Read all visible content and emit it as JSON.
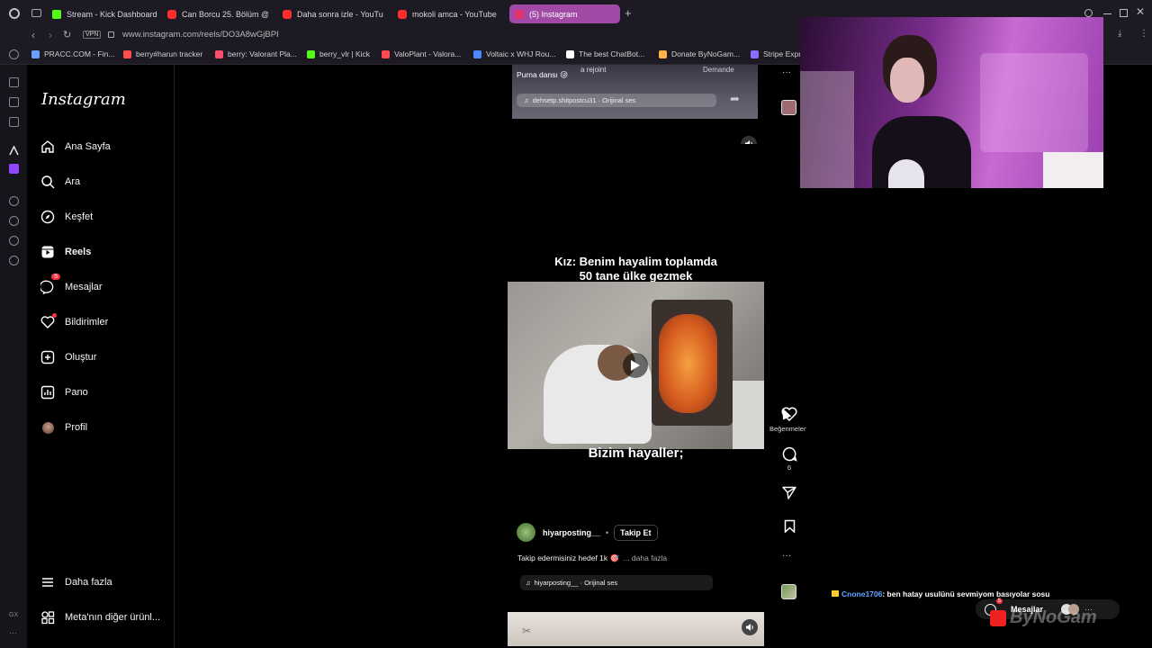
{
  "browser": {
    "tabs": [
      {
        "title": "Stream - Kick Dashboard",
        "color": "#53fc18"
      },
      {
        "title": "Can Borcu 25. Bölüm @...",
        "color": "#ff2d2d"
      },
      {
        "title": "Daha sonra izle - YouTube",
        "color": "#ff2d2d"
      },
      {
        "title": "mokoli amca - YouTube",
        "color": "#ff2d2d"
      },
      {
        "title": "(5) Instagram",
        "color": "#e1306c"
      }
    ],
    "url": "www.instagram.com/reels/DO3A8wGjBPI",
    "vpn_label": "VPN",
    "bookmarks": [
      {
        "label": "PRACC.COM - Fin...",
        "color": "#6aa0ff"
      },
      {
        "label": "berry#harun tracker",
        "color": "#ff4d4d"
      },
      {
        "label": "berry: Valorant Pla...",
        "color": "#ff4d6d"
      },
      {
        "label": "berry_vlr | Kick",
        "color": "#53fc18"
      },
      {
        "label": "ValoPlant - Valora...",
        "color": "#ff4655"
      },
      {
        "label": "Voltaic x WHJ Rou...",
        "color": "#4a8cff"
      },
      {
        "label": "The best ChatBot...",
        "color": "#ffffff"
      },
      {
        "label": "Donate ByNoGam...",
        "color": "#ffb347"
      },
      {
        "label": "Stripe Expr...",
        "color": "#8a6cff"
      }
    ]
  },
  "instagram": {
    "logo": "Instagram",
    "nav": [
      {
        "label": "Ana Sayfa",
        "icon": "home-icon"
      },
      {
        "label": "Ara",
        "icon": "search-icon"
      },
      {
        "label": "Keşfet",
        "icon": "compass-icon"
      },
      {
        "label": "Reels",
        "icon": "reels-icon"
      },
      {
        "label": "Mesajlar",
        "icon": "messenger-icon",
        "badge": "5"
      },
      {
        "label": "Bildirimler",
        "icon": "heart-icon"
      },
      {
        "label": "Oluştur",
        "icon": "plus-icon"
      },
      {
        "label": "Pano",
        "icon": "dashboard-icon"
      },
      {
        "label": "Profil",
        "icon": "avatar-icon"
      }
    ],
    "more_label": "Daha fazla",
    "meta_label": "Meta'nın diğer ürünl..."
  },
  "prev_reel": {
    "caption": "Purna dansı 😜",
    "audio": "dehsetp.shitpostcu31 · Orijinal ses",
    "overlay_left": "a rejoint",
    "overlay_right": "Demande"
  },
  "current_reel": {
    "top_text_line1": "Kız: Benim hayalim toplamda",
    "top_text_line2": "50 tane ülke gezmek",
    "bottom_text": "Bizim hayaller;",
    "username": "hiyarposting__",
    "follow_label": "Takip Et",
    "caption": "Takip edermisiniz hedef 1k 🎯",
    "more_label": "... daha fazla",
    "audio": "hiyarposting__ · Orijinal ses",
    "likes_label": "Beğenmeler",
    "comments_count": "6"
  },
  "overlay": {
    "chat_user": "Cnone1706",
    "chat_message": ": ben hatay usulünü sevmiyom basıyolar sosu",
    "mesajlar_label": "Mesajlar",
    "mesajlar_badge": "5",
    "watermark": "ByNoGam"
  }
}
